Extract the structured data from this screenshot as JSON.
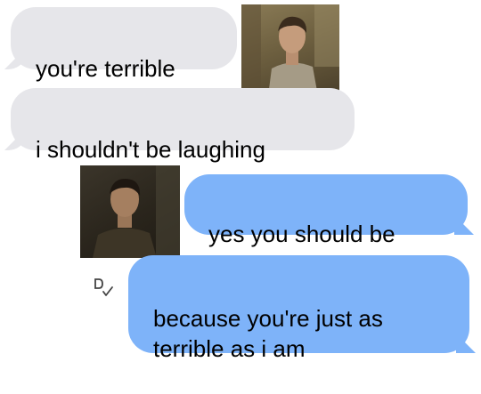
{
  "conversation": {
    "messages": [
      {
        "sender": "them",
        "text": "you're terrible"
      },
      {
        "sender": "them",
        "text": "i shouldn't be laughing"
      },
      {
        "sender": "me",
        "text": "yes you should be"
      },
      {
        "sender": "me",
        "text": "because you're just as\nterrible as i am"
      }
    ]
  },
  "colors": {
    "received_bubble": "#e6e6ea",
    "sent_bubble": "#7eb3f9"
  },
  "icons": {
    "read_receipt": "read-check-icon"
  }
}
